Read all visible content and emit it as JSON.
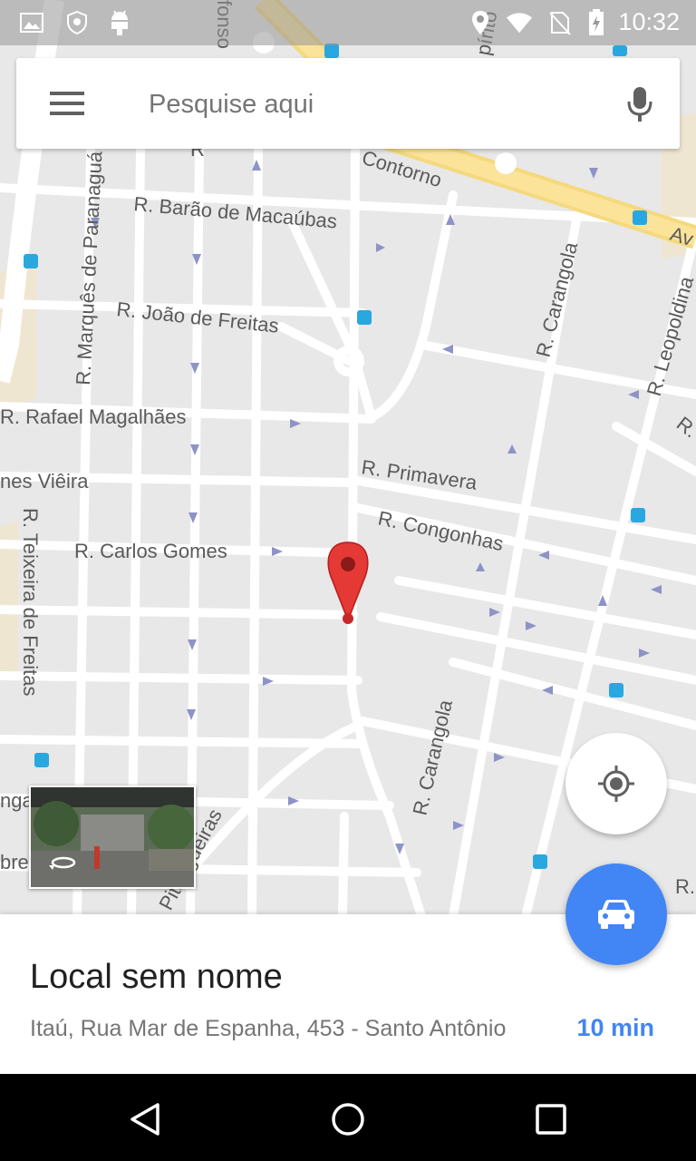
{
  "status_bar": {
    "time": "10:32",
    "icons": [
      "image-icon",
      "shield-icon",
      "android-icon",
      "location-icon",
      "wifi-icon",
      "no-sim-icon",
      "battery-charging-icon"
    ]
  },
  "search": {
    "placeholder": "Pesquise aqui",
    "menu_icon": "hamburger-menu-icon",
    "mic_icon": "microphone-icon"
  },
  "map": {
    "streets": [
      "Contorno",
      "R. Barão de Macaúbas",
      "R. Marquês de Paranaguá",
      "R. João de Freitas",
      "R. Rafael Magalhães",
      "nes Viêira",
      "R. Primavera",
      "R. Congonhas",
      "R. Carlos Gomes",
      "R. Teixeira de Freitas",
      "R. Carangola",
      "R. Carangola",
      "R. Leopoldina",
      "Pitangueiras",
      "Av",
      "fonso",
      "pírito",
      "R. S",
      "R.",
      "nga",
      "bre",
      "R"
    ],
    "marker_icon": "red-map-pin-icon"
  },
  "controls": {
    "locate_icon": "my-location-icon",
    "directions_icon": "car-icon",
    "streetview_icon": "360-rotate-icon"
  },
  "place": {
    "title": "Local sem nome",
    "address": "Itaú, Rua Mar de Espanha, 453 - Santo Antônio",
    "drive_time": "10 min"
  },
  "nav": {
    "back_icon": "back-triangle-icon",
    "home_icon": "home-circle-icon",
    "recents_icon": "recents-square-icon"
  },
  "colors": {
    "accent": "#4285f4",
    "map_background": "#e8e8e8",
    "road": "#ffffff",
    "major_road": "#f8dc8c",
    "marker": "#e53935"
  }
}
